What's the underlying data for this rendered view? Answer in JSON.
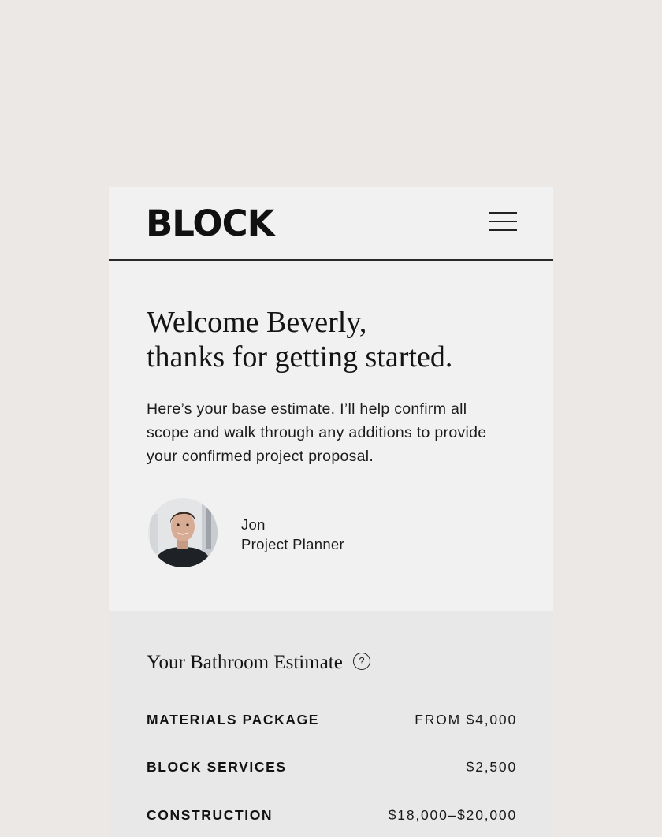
{
  "header": {
    "logo": "BLOCK",
    "menu_icon": "hamburger-menu-icon"
  },
  "welcome": {
    "line1": "Welcome Beverly,",
    "line2": "thanks for getting started."
  },
  "intro": "Here’s your base estimate. I’ll help confirm all scope and walk through any additions to provide your confirmed project proposal.",
  "planner": {
    "name": "Jon",
    "role": "Project Planner"
  },
  "estimate": {
    "title": "Your Bathroom Estimate",
    "help_icon": "?",
    "items": [
      {
        "label": "MATERIALS PACKAGE",
        "value": "FROM $4,000"
      },
      {
        "label": "BLOCK SERVICES",
        "value": "$2,500"
      },
      {
        "label": "CONSTRUCTION",
        "value": "$18,000–$20,000"
      }
    ]
  }
}
